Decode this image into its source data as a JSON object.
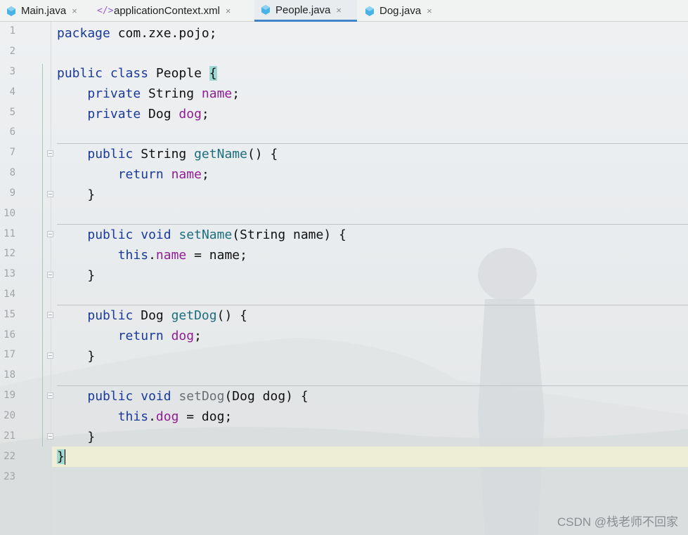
{
  "tabs": [
    {
      "label": "Main.java",
      "icon": "java-class-icon",
      "active": false
    },
    {
      "label": "applicationContext.xml",
      "icon": "xml-file-icon",
      "active": false
    },
    {
      "label": "People.java",
      "icon": "java-class-icon",
      "active": true
    },
    {
      "label": "Dog.java",
      "icon": "java-class-icon",
      "active": false
    }
  ],
  "close_glyph": "×",
  "editor": {
    "line_numbers": [
      "1",
      "2",
      "3",
      "4",
      "5",
      "6",
      "7",
      "8",
      "9",
      "10",
      "11",
      "12",
      "13",
      "14",
      "15",
      "16",
      "17",
      "18",
      "19",
      "20",
      "21",
      "22",
      "23"
    ],
    "current_line": "22",
    "code": {
      "l1": {
        "kw": "package",
        "rest": " com.zxe.pojo;"
      },
      "l3": {
        "kw1": "public",
        "kw2": "class",
        "name": " People ",
        "brace": "{"
      },
      "l4": {
        "indent": "    ",
        "kw": "private",
        "type": " String ",
        "field": "name",
        "end": ";"
      },
      "l5": {
        "indent": "    ",
        "kw": "private",
        "type": " Dog ",
        "field": "dog",
        "end": ";"
      },
      "l7": {
        "indent": "    ",
        "kw": "public",
        "type": " String ",
        "method": "getName",
        "rest": "() {"
      },
      "l8": {
        "indent": "        ",
        "kw": "return",
        "field": "name",
        "end": ";"
      },
      "l9": {
        "indent": "    ",
        "text": "}"
      },
      "l11": {
        "indent": "    ",
        "kw1": "public",
        "kw2": "void",
        "method": "setName",
        "rest": "(String name) {"
      },
      "l12": {
        "indent": "        ",
        "kw": "this",
        "dot": ".",
        "field": "name",
        "rest": " = name;"
      },
      "l13": {
        "indent": "    ",
        "text": "}"
      },
      "l15": {
        "indent": "    ",
        "kw": "public",
        "type": " Dog ",
        "method": "getDog",
        "rest": "() {"
      },
      "l16": {
        "indent": "        ",
        "kw": "return",
        "field": "dog",
        "end": ";"
      },
      "l17": {
        "indent": "    ",
        "text": "}"
      },
      "l19": {
        "indent": "    ",
        "kw1": "public",
        "kw2": "void",
        "method": "setDog",
        "rest": "(Dog dog) {"
      },
      "l20": {
        "indent": "        ",
        "kw": "this",
        "dot": ".",
        "field": "dog",
        "rest": " = dog;"
      },
      "l21": {
        "indent": "    ",
        "text": "}"
      },
      "l22": {
        "brace": "}"
      }
    }
  },
  "watermark": "CSDN @栈老师不回家",
  "colors": {
    "keyword": "#1a3a9a",
    "field": "#8f1e93",
    "method": "#1d6e7c",
    "active_tab_underline": "#4083c9"
  }
}
